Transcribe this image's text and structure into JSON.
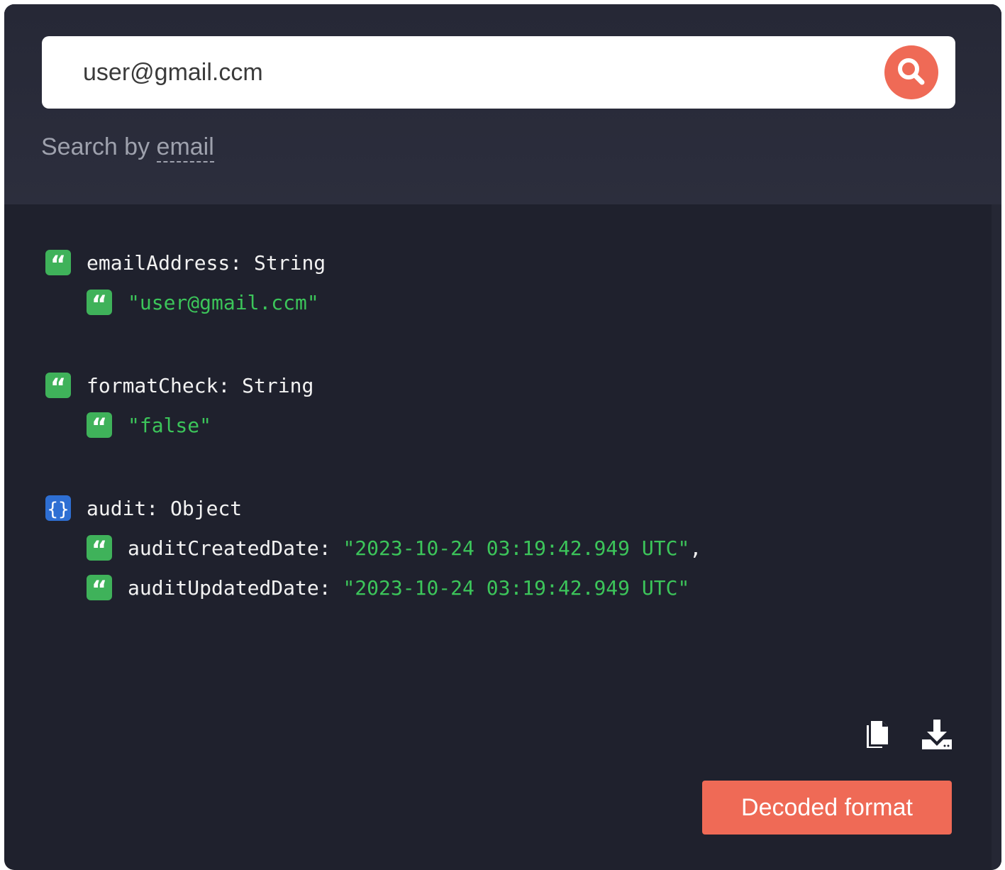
{
  "search": {
    "value": "user@gmail.ccm",
    "hint_prefix": "Search by ",
    "hint_field": "email"
  },
  "result": {
    "fields": [
      {
        "key": "emailAddress",
        "type": "String",
        "value": "\"user@gmail.ccm\""
      },
      {
        "key": "formatCheck",
        "type": "String",
        "value": "\"false\""
      },
      {
        "key": "audit",
        "type": "Object",
        "children": [
          {
            "key": "auditCreatedDate",
            "value": "\"2023-10-24 03:19:42.949 UTC\"",
            "trailing": ","
          },
          {
            "key": "auditUpdatedDate",
            "value": "\"2023-10-24 03:19:42.949 UTC\"",
            "trailing": ""
          }
        ]
      }
    ]
  },
  "actions": {
    "copy_icon": "copy-icon",
    "download_icon": "download-icon",
    "decoded_label": "Decoded format"
  },
  "colors": {
    "background": "#1f212d",
    "accent": "#ef6a56",
    "string_green": "#3cc55a",
    "badge_green": "#3fb25a",
    "badge_blue": "#2e6fd3"
  }
}
